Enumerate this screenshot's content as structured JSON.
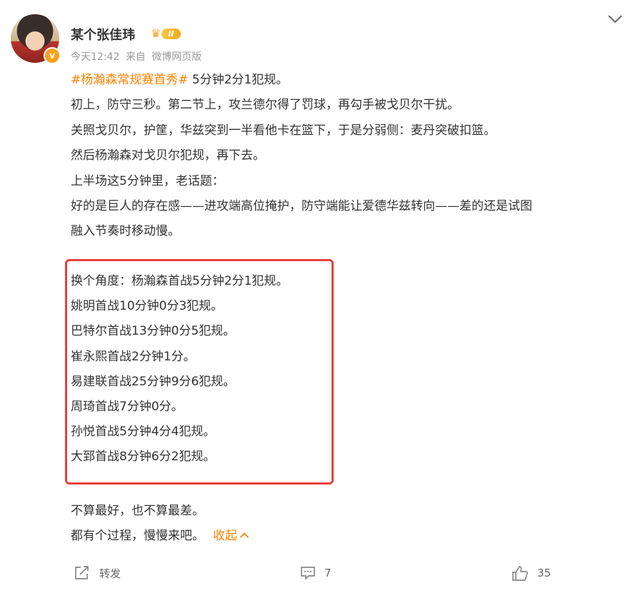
{
  "user": {
    "name": "某个张佳玮",
    "vip_level": "II",
    "verified_mark": "v"
  },
  "meta": {
    "time": "今天12:42",
    "source_prefix": "来自",
    "source": "微博网页版"
  },
  "post": {
    "hashtag": "#杨瀚森常规赛首秀#",
    "headline": " 5分钟2分1犯规。",
    "lines": [
      "初上，防守三秒。第二节上，攻兰德尔得了罚球，再勾手被戈贝尔干扰。",
      "关照戈贝尔，护筐，华兹突到一半看他卡在篮下，于是分弱侧：麦丹突破扣篮。",
      "然后杨瀚森对戈贝尔犯规，再下去。",
      "上半场这5分钟里，老话题：",
      "好的是巨人的存在感——进攻端高位掩护，防守端能让爱德华兹转向——差的还是试图",
      "融入节奏时移动慢。"
    ],
    "boxed_lines": [
      "换个角度：杨瀚森首战5分钟2分1犯规。",
      "姚明首战10分钟0分3犯规。",
      "巴特尔首战13分钟0分5犯规。",
      "崔永熙首战2分钟1分。",
      "易建联首战25分钟9分6犯规。",
      "周琦首战7分钟0分。",
      "孙悦首战5分钟4分4犯规。",
      "大郅首战8分钟6分2犯规。"
    ],
    "closing_lines": [
      "不算最好，也不算最差。",
      "都有个过程，慢慢来吧。"
    ],
    "collapse_label": "收起"
  },
  "actions": {
    "repost_label": "转发",
    "comment_count": "7",
    "like_count": "35"
  },
  "colors": {
    "accent": "#ff8200",
    "highlight_box": "#e8403f",
    "meta_text": "#999999"
  },
  "icons": [
    "chevron-down-icon",
    "vip-crown-icon",
    "verified-icon",
    "repost-icon",
    "comment-icon",
    "like-icon"
  ]
}
